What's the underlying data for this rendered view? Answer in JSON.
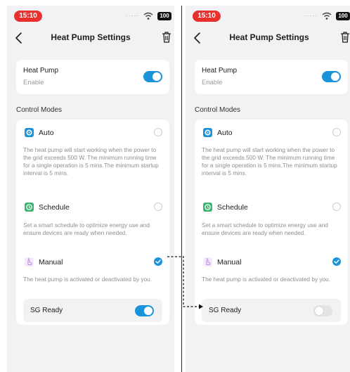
{
  "screens": [
    {
      "status_bar": {
        "time": "15:10",
        "signal": "·····",
        "battery": "100"
      },
      "nav": {
        "title": "Heat Pump Settings"
      },
      "heat_pump": {
        "title": "Heat Pump",
        "subtitle": "Enable",
        "enabled": true
      },
      "section_title": "Control Modes",
      "modes": {
        "auto": {
          "label": "Auto",
          "description": "The heat pump will start working when the power to the grid exceeds 500 W. The minimum running time for a single operation is 5 mins.The minimum startup interval is 5 mins.",
          "selected": false
        },
        "schedule": {
          "label": "Schedule",
          "description": "Set a smart schedule to optimize energy use and ensure devices are ready when needed.",
          "selected": false
        },
        "manual": {
          "label": "Manual",
          "description": "The heat pump is activated or deactivated by you.",
          "selected": true
        }
      },
      "sg_ready": {
        "label": "SG Ready",
        "enabled": true
      }
    },
    {
      "status_bar": {
        "time": "15:10",
        "signal": "·····",
        "battery": "100"
      },
      "nav": {
        "title": "Heat Pump Settings"
      },
      "heat_pump": {
        "title": "Heat Pump",
        "subtitle": "Enable",
        "enabled": true
      },
      "section_title": "Control Modes",
      "modes": {
        "auto": {
          "label": "Auto",
          "description": "The heat pump will start working when the power to the grid exceeds 500 W. The minimum running time for a single operation is 5 mins.The minimum startup interval is 5 mins.",
          "selected": false
        },
        "schedule": {
          "label": "Schedule",
          "description": "Set a smart schedule to optimize energy use and ensure devices are ready when needed.",
          "selected": false
        },
        "manual": {
          "label": "Manual",
          "description": "The heat pump is activated or deactivated by you.",
          "selected": true
        }
      },
      "sg_ready": {
        "label": "SG Ready",
        "enabled": false
      }
    }
  ],
  "colors": {
    "accent": "#1a93d9",
    "status_time_bg": "#e8312f",
    "auto_icon": "#1a93d9",
    "schedule_icon": "#3cb371",
    "manual_icon": "#b98be0"
  },
  "icons": [
    "back-arrow-icon",
    "trash-icon",
    "wifi-icon",
    "battery-icon",
    "auto-gear-icon",
    "schedule-clock-icon",
    "manual-hand-icon",
    "checkmark-icon"
  ]
}
